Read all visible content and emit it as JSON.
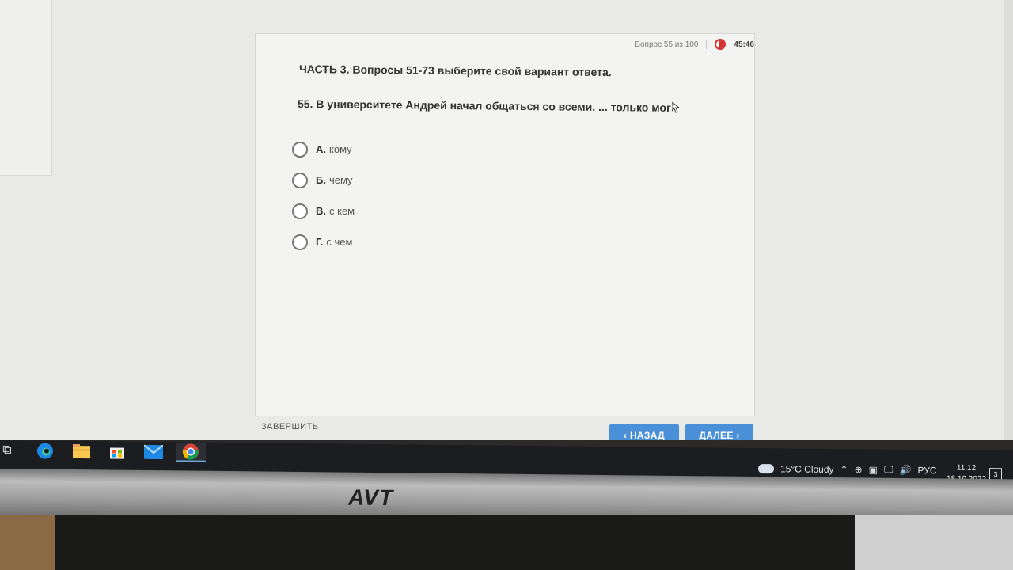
{
  "test": {
    "progress_text": "Вопрос 55 из 100",
    "timer": "45:46",
    "part_title": "ЧАСТЬ 3. Вопросы 51-73 выберите свой вариант ответа.",
    "question": "55. В университете Андрей начал общаться со всеми, ... только мог",
    "options": [
      {
        "letter": "А.",
        "text": "кому"
      },
      {
        "letter": "Б.",
        "text": "чему"
      },
      {
        "letter": "В.",
        "text": "с кем"
      },
      {
        "letter": "Г.",
        "text": "с чем"
      }
    ],
    "finish_label": "ЗАВЕРШИТЬ",
    "back_label": "‹ НАЗАД",
    "next_label": "ДАЛЕЕ ›"
  },
  "taskbar": {
    "weather": "15°C Cloudy",
    "language": "РУС",
    "time": "11:12",
    "date": "18.10.2022",
    "notifications": "3"
  },
  "monitor": {
    "brand": "AVT"
  }
}
